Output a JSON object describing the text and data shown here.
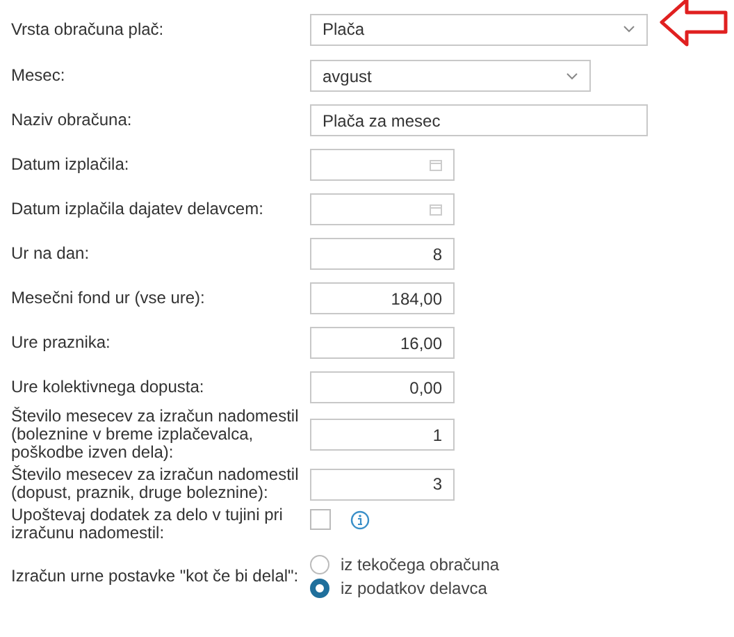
{
  "fields": [
    {
      "label": "Vrsta obračuna plač:",
      "kind": "select",
      "value": "Plača"
    },
    {
      "label": "Mesec:",
      "kind": "select",
      "value": "avgust"
    },
    {
      "label": "Naziv obračuna:",
      "kind": "text",
      "value": "Plača za mesec"
    },
    {
      "label": "Datum izplačila:",
      "kind": "date"
    },
    {
      "label": "Datum izplačila dajatev delavcem:",
      "kind": "date"
    },
    {
      "label": "Ur na dan:",
      "kind": "number",
      "value": "8"
    },
    {
      "label": "Mesečni fond ur (vse ure):",
      "kind": "number",
      "value": "184,00"
    },
    {
      "label": "Ure praznika:",
      "kind": "number",
      "value": "16,00"
    },
    {
      "label": "Ure kolektivnega dopusta:",
      "kind": "number",
      "value": "0,00"
    },
    {
      "label": "Število mesecev za izračun nadomestil (boleznine v breme izplačevalca, poškodbe izven dela):",
      "kind": "number",
      "value": "1"
    },
    {
      "label": "Število mesecev za izračun nadomestil (dopust, praznik, druge boleznine):",
      "kind": "number",
      "value": "3"
    },
    {
      "label": "Upoštevaj dodatek za delo v tujini pri izračunu nadomestil:",
      "kind": "checkbox",
      "checked": false
    },
    {
      "label": "Izračun urne postavke \"kot če bi delal\":",
      "kind": "radio",
      "options": [
        {
          "label": "iz tekočega obračuna",
          "selected": false
        },
        {
          "label": "iz podatkov delavca",
          "selected": true
        }
      ]
    }
  ]
}
